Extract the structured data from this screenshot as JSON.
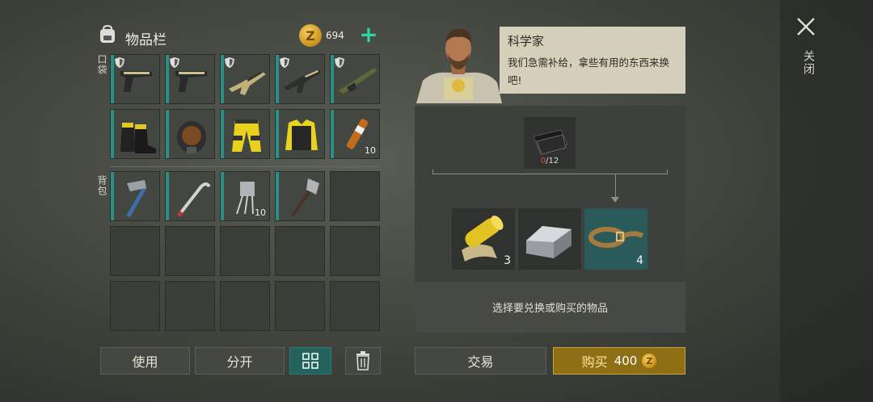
{
  "inventory": {
    "title": "物品栏",
    "coins": "694",
    "pocket_label": "口袋",
    "backpack_label": "背包",
    "pocket_slots": [
      {
        "icon": "pistol-icon",
        "shield": true,
        "qty": ""
      },
      {
        "icon": "pistol-icon",
        "shield": true,
        "qty": ""
      },
      {
        "icon": "assault-rifle-icon",
        "shield": true,
        "qty": ""
      },
      {
        "icon": "smg-icon",
        "shield": true,
        "qty": ""
      },
      {
        "icon": "shotgun-icon",
        "shield": true,
        "qty": ""
      },
      {
        "icon": "boots-icon",
        "shield": false,
        "qty": ""
      },
      {
        "icon": "gas-mask-icon",
        "shield": false,
        "qty": ""
      },
      {
        "icon": "pants-icon",
        "shield": false,
        "qty": ""
      },
      {
        "icon": "vest-icon",
        "shield": false,
        "qty": ""
      },
      {
        "icon": "syringe-icon",
        "shield": false,
        "qty": "10"
      }
    ],
    "backpack_slots": [
      {
        "icon": "hatchet-icon",
        "qty": ""
      },
      {
        "icon": "crowbar-icon",
        "qty": ""
      },
      {
        "icon": "transistor-icon",
        "qty": "10"
      },
      {
        "icon": "shovel-icon",
        "qty": ""
      }
    ]
  },
  "actions": {
    "use_label": "使用",
    "split_label": "分开"
  },
  "trader": {
    "name": "科学家",
    "message": "我们急需补给，拿些有用的东西来换吧!",
    "required": {
      "icon": "cloth-icon",
      "have": "0",
      "need": "/12"
    },
    "rewards": [
      {
        "icon": "duct-tape-roll-icon",
        "qty": "3"
      },
      {
        "icon": "metal-ingot-icon",
        "qty": ""
      },
      {
        "icon": "leather-strap-icon",
        "qty": "4",
        "selected": true
      }
    ],
    "hint": "选择要兑换或购买的物品",
    "trade_label": "交易",
    "buy_label": "购买",
    "buy_price": "400"
  },
  "window": {
    "close_label": "关闭"
  },
  "colors": {
    "accent_teal": "#2fd3a8",
    "gold": "#c8a23a",
    "selected_bg": "#2a5b5a"
  }
}
